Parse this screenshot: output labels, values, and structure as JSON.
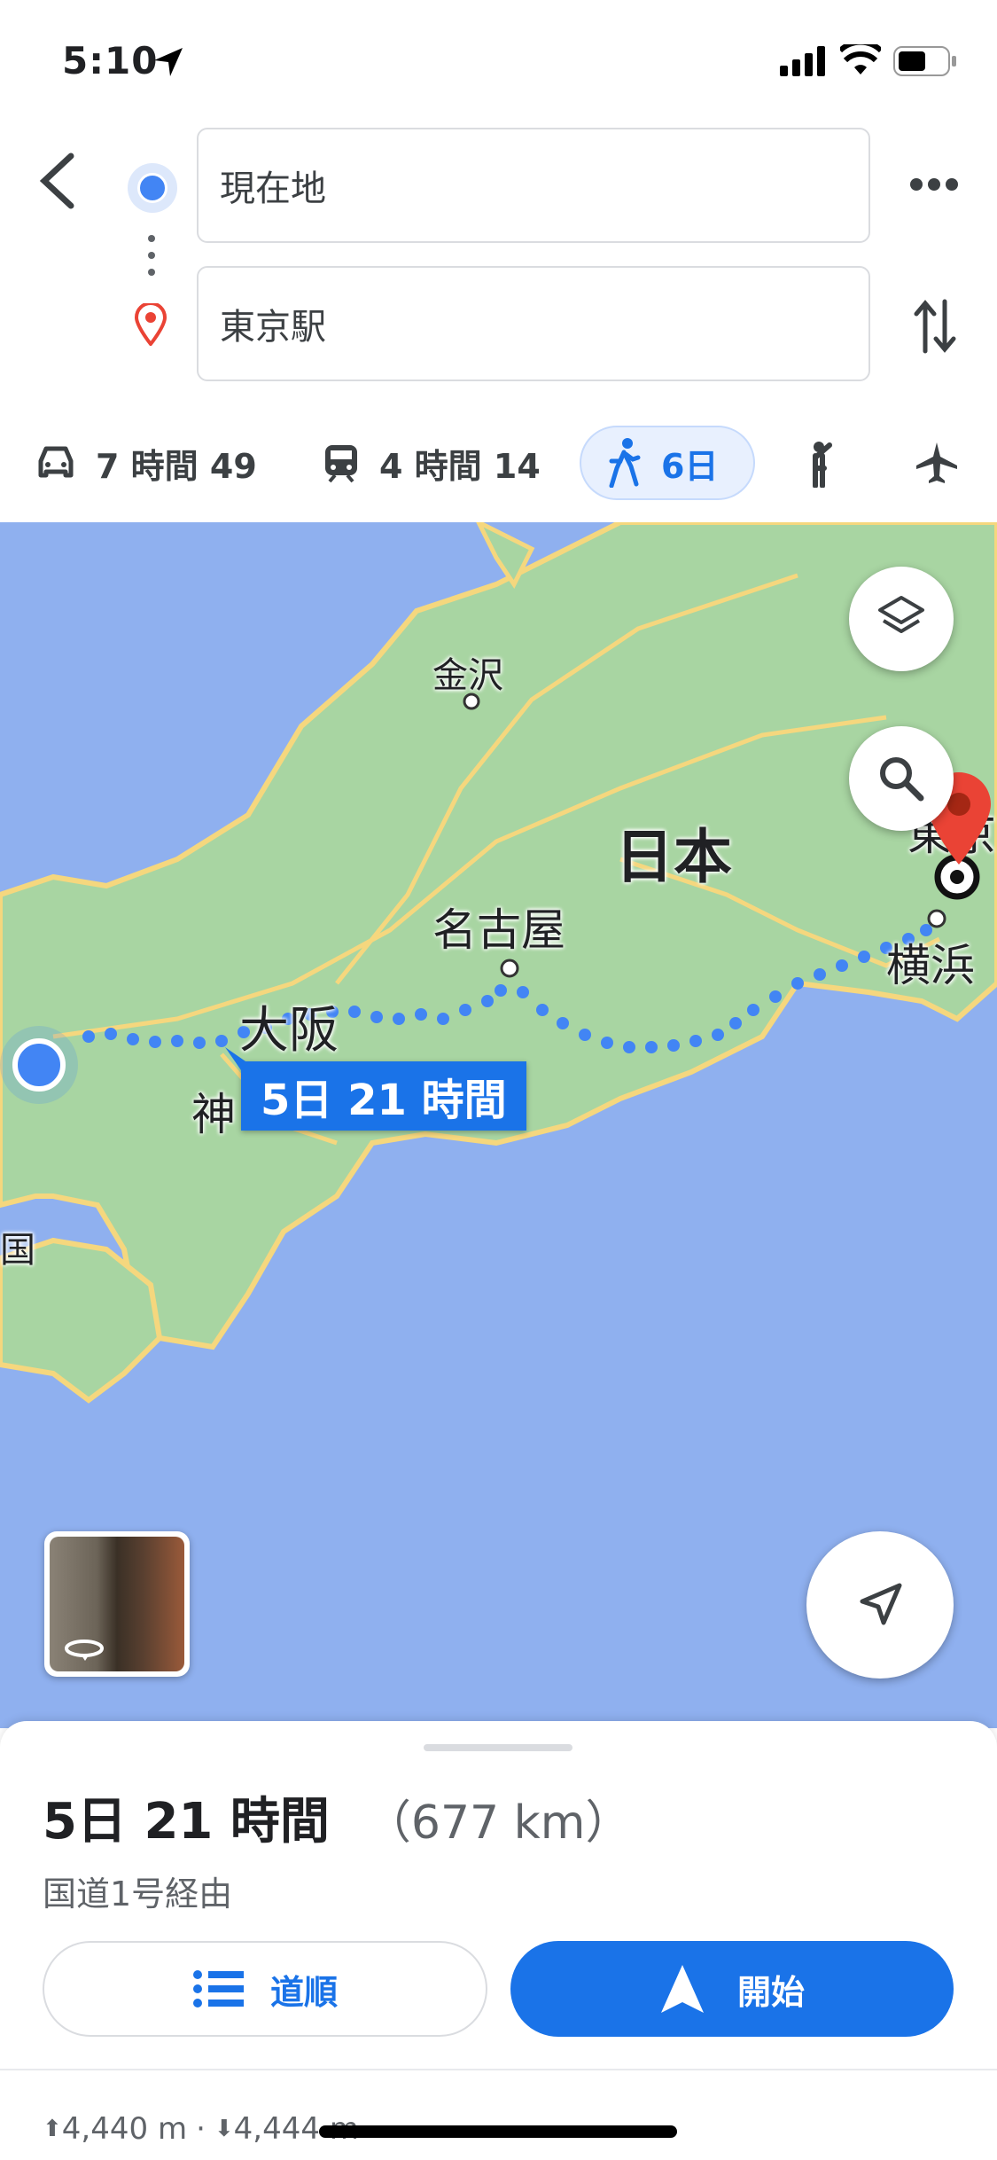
{
  "status": {
    "time": "5:10"
  },
  "search": {
    "origin_value": "現在地",
    "destination_value": "東京駅"
  },
  "modes": [
    {
      "icon": "car-icon",
      "label": "7 時間 49"
    },
    {
      "icon": "train-icon",
      "label": "4 時間 14"
    },
    {
      "icon": "walk-icon",
      "label": "6日",
      "active": true
    },
    {
      "icon": "ride-hail-icon",
      "label": ""
    },
    {
      "icon": "airplane-icon",
      "label": ""
    }
  ],
  "map": {
    "labels": {
      "kanazawa": "金沢",
      "nihon": "日本",
      "nagoya": "名古屋",
      "osaka": "大阪",
      "kobe": "神",
      "yokohama": "横浜",
      "tokyo": "東京",
      "shikoku": "国"
    },
    "route_callout": "5日 21 時間",
    "colors": {
      "water": "#8fb0ef",
      "land": "#a8d5a2",
      "route": "#4285f4",
      "callout": "#1a73e8",
      "pin": "#ea4335"
    }
  },
  "summary": {
    "duration": "5日 21 時間",
    "distance": "（677 km）",
    "via": "国道1号経由",
    "steps_label": "道順",
    "start_label": "開始",
    "elevation_up": "4,440 m",
    "elevation_down": "4,444 m"
  }
}
